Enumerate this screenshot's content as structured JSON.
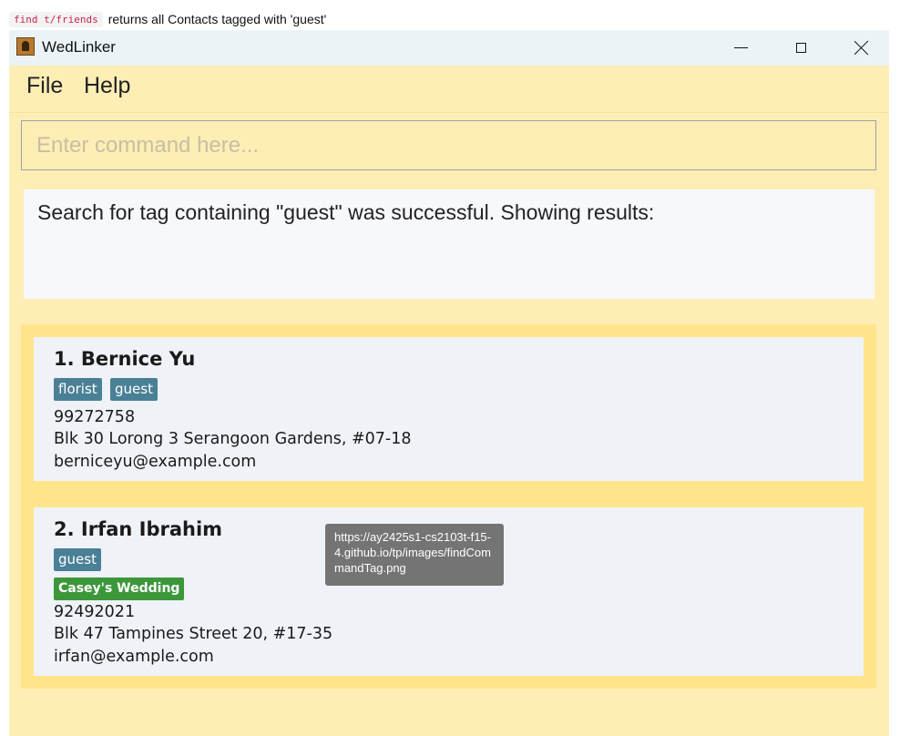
{
  "caption": {
    "code": "find t/friends",
    "text": "returns all Contacts tagged with 'guest'"
  },
  "window": {
    "title": "WedLinker",
    "icon": "address-book-icon",
    "controls": [
      "minimize-icon",
      "maximize-icon",
      "close-icon"
    ]
  },
  "menu": {
    "file": "File",
    "help": "Help"
  },
  "command": {
    "value": "",
    "placeholder": "Enter command here..."
  },
  "result": {
    "message": "Search for tag containing \"guest\" was successful.  Showing results:"
  },
  "contacts": [
    {
      "name": "1. Bernice Yu",
      "tags": [
        "florist",
        "guest"
      ],
      "wedding_tags": [],
      "phone": "99272758",
      "address": "Blk 30 Lorong 3 Serangoon Gardens, #07-18",
      "email": "berniceyu@example.com"
    },
    {
      "name": "2. Irfan Ibrahim",
      "tags": [
        "guest"
      ],
      "wedding_tags": [
        "Casey's Wedding"
      ],
      "phone": "92492021",
      "address": "Blk 47 Tampines Street 20, #17-35",
      "email": "irfan@example.com"
    }
  ],
  "tooltip": {
    "text": "https://ay2425s1-cs2103t-f15-4.github.io/tp/images/findCommandTag.png"
  },
  "colors": {
    "window_bg": "#feeeb5",
    "list_bg": "#ffe58a",
    "card_bg": "#eff2f7",
    "tag_bg": "#4a8096",
    "wedding_tag_bg": "#3c973b",
    "titlebar_bg": "#ebf3f6"
  }
}
